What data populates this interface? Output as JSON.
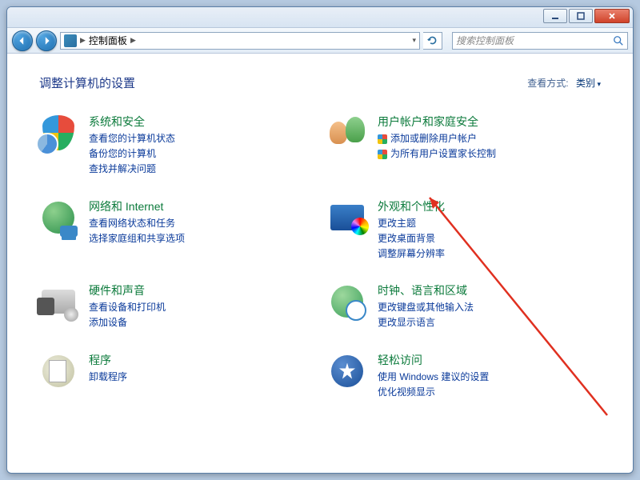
{
  "titlebar": {
    "min": "minimize",
    "max": "maximize",
    "close": "close"
  },
  "nav": {
    "location": "控制面板"
  },
  "search": {
    "placeholder": "搜索控制面板"
  },
  "header": {
    "title": "调整计算机的设置",
    "viewby_label": "查看方式:",
    "viewby_value": "类别"
  },
  "cats": {
    "left": [
      {
        "icon": "shield",
        "title": "系统和安全",
        "subs": [
          {
            "label": "查看您的计算机状态"
          },
          {
            "label": "备份您的计算机"
          },
          {
            "label": "查找并解决问题"
          }
        ]
      },
      {
        "icon": "net",
        "title": "网络和 Internet",
        "subs": [
          {
            "label": "查看网络状态和任务"
          },
          {
            "label": "选择家庭组和共享选项"
          }
        ]
      },
      {
        "icon": "hw",
        "title": "硬件和声音",
        "subs": [
          {
            "label": "查看设备和打印机"
          },
          {
            "label": "添加设备"
          }
        ]
      },
      {
        "icon": "prog",
        "title": "程序",
        "subs": [
          {
            "label": "卸载程序"
          }
        ]
      }
    ],
    "right": [
      {
        "icon": "user",
        "title": "用户帐户和家庭安全",
        "subs": [
          {
            "label": "添加或删除用户帐户",
            "shield": true
          },
          {
            "label": "为所有用户设置家长控制",
            "shield": true
          }
        ]
      },
      {
        "icon": "appear",
        "title": "外观和个性化",
        "subs": [
          {
            "label": "更改主题"
          },
          {
            "label": "更改桌面背景"
          },
          {
            "label": "调整屏幕分辨率"
          }
        ]
      },
      {
        "icon": "clock",
        "title": "时钟、语言和区域",
        "subs": [
          {
            "label": "更改键盘或其他输入法"
          },
          {
            "label": "更改显示语言"
          }
        ]
      },
      {
        "icon": "ease",
        "title": "轻松访问",
        "subs": [
          {
            "label": "使用 Windows 建议的设置"
          },
          {
            "label": "优化视频显示"
          }
        ]
      }
    ]
  }
}
